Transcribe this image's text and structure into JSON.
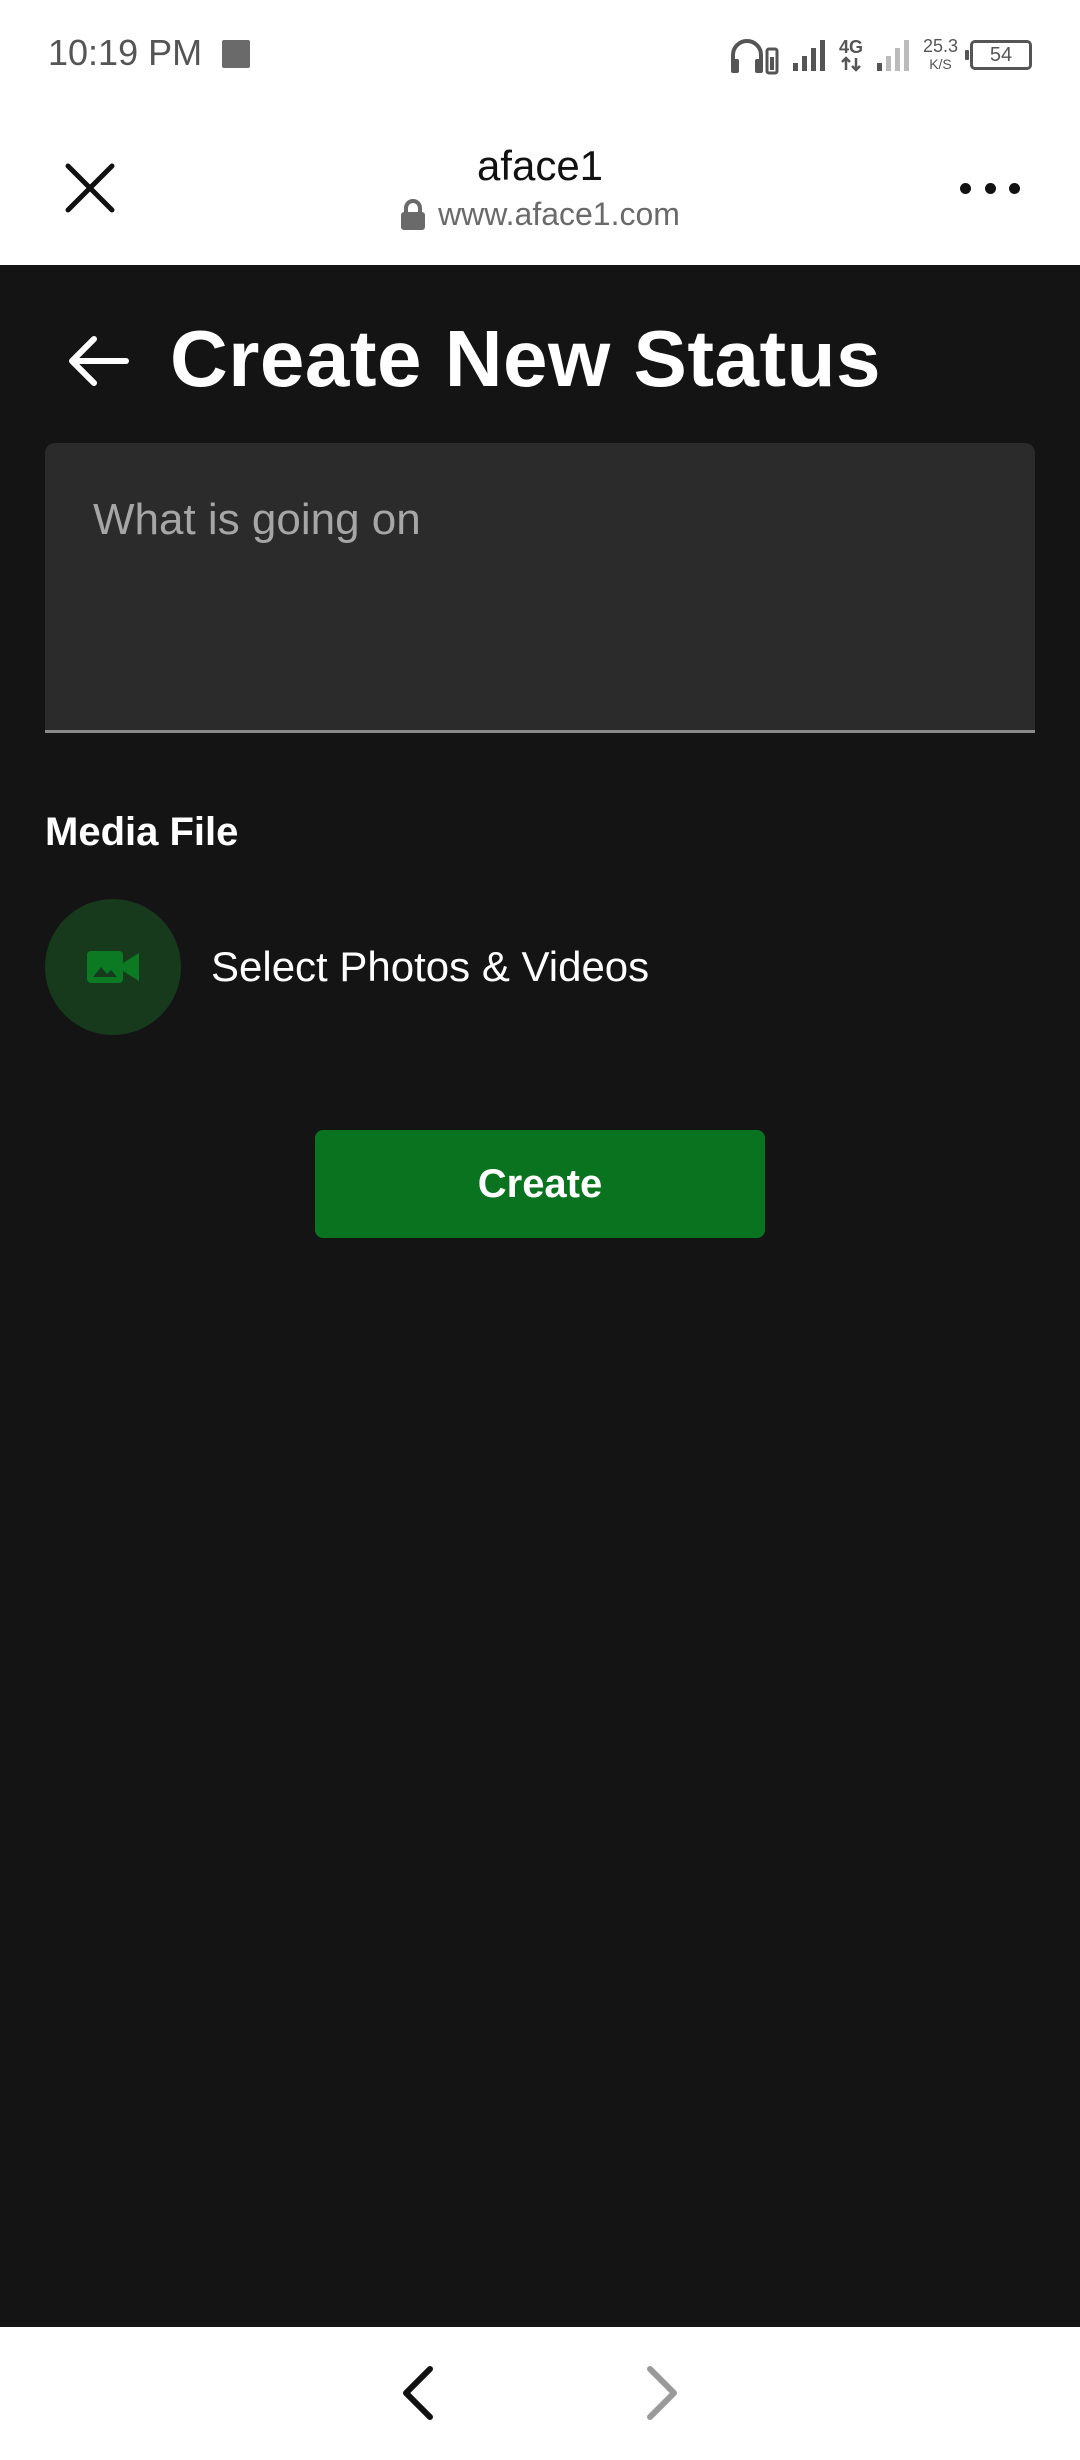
{
  "status_bar": {
    "time": "10:19 PM",
    "network_type": "4G",
    "net_speed_value": "25.3",
    "net_speed_unit": "K/S",
    "battery_level": "54"
  },
  "browser": {
    "site_title": "aface1",
    "site_url": "www.aface1.com"
  },
  "page": {
    "title": "Create New Status",
    "status_input": {
      "placeholder": "What is going on",
      "value": ""
    },
    "media_section_label": "Media File",
    "media_select_label": "Select Photos & Videos",
    "create_button_label": "Create"
  },
  "colors": {
    "background": "#141414",
    "input_background": "#2b2b2b",
    "accent_green": "#0a731f",
    "icon_green": "#0b7a22",
    "icon_circle": "#173a1d"
  },
  "icons": {
    "close": "close-icon",
    "lock": "lock-icon",
    "menu": "more-horizontal-icon",
    "back": "arrow-left-icon",
    "media": "video-camera-icon",
    "nav_back": "chevron-left-icon",
    "nav_forward": "chevron-right-icon"
  }
}
